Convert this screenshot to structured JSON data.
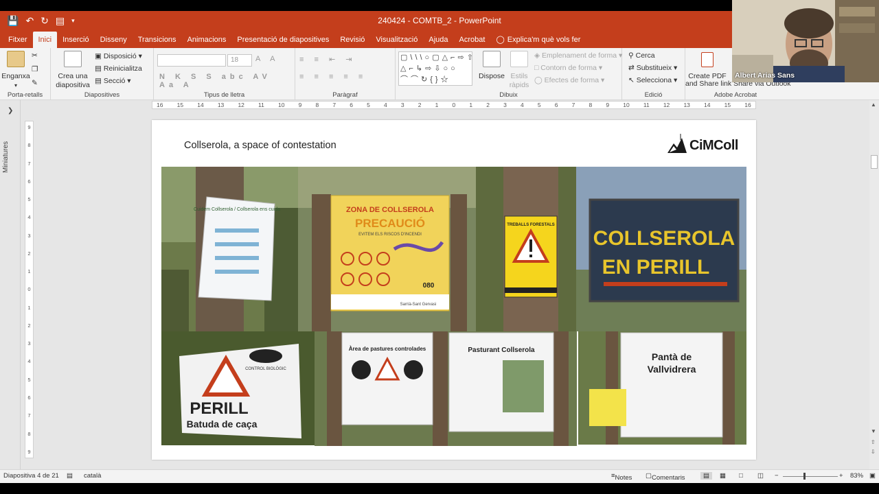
{
  "window": {
    "title": "240424 - COMTB_2  -  PowerPoint"
  },
  "menu": {
    "tabs": [
      "Fitxer",
      "Inici",
      "Inserció",
      "Disseny",
      "Transicions",
      "Animacions",
      "Presentació de diapositives",
      "Revisió",
      "Visualització",
      "Ajuda",
      "Acrobat"
    ],
    "active": "Inici",
    "tell_me": "Explica'm què vols fer"
  },
  "ribbon": {
    "clipboard": {
      "paste": "Enganxa",
      "label": "Porta-retalls"
    },
    "slides": {
      "new_slide_1": "Crea una",
      "new_slide_2": "diapositiva",
      "layout": "Disposició",
      "reset": "Reinicialitza",
      "section": "Secció",
      "label": "Diapositives"
    },
    "font": {
      "size": "18",
      "label": "Tipus de lletra"
    },
    "paragraph": {
      "label": "Paràgraf"
    },
    "drawing": {
      "arrange": "Dispose",
      "quick_styles_1": "Estils",
      "quick_styles_2": "ràpids",
      "fill": "Emplenament de forma",
      "outline": "Contorn de forma",
      "effects": "Efectes de forma",
      "label": "Dibuix"
    },
    "editing": {
      "find": "Cerca",
      "replace": "Substitueix",
      "select": "Selecciona",
      "label": "Edició"
    },
    "acrobat": {
      "create_pdf": "Create PDF",
      "share_link": "and Share link",
      "label": "Adobe Acrobat"
    },
    "share_outlook": "Share via Outlook"
  },
  "panes": {
    "thumbnails_label": "Miniatures"
  },
  "ruler": {
    "h_ticks": [
      "16",
      "15",
      "14",
      "13",
      "12",
      "11",
      "10",
      "9",
      "8",
      "7",
      "6",
      "5",
      "4",
      "3",
      "2",
      "1",
      "0",
      "1",
      "2",
      "3",
      "4",
      "5",
      "6",
      "7",
      "8",
      "9",
      "10",
      "11",
      "12",
      "13",
      "14",
      "15",
      "16"
    ],
    "v_ticks": [
      "9",
      "8",
      "7",
      "6",
      "5",
      "4",
      "3",
      "2",
      "1",
      "0",
      "1",
      "2",
      "3",
      "4",
      "5",
      "6",
      "7",
      "8",
      "9"
    ]
  },
  "slide": {
    "title": "Collserola, a space of contestation",
    "logo_text": "CiMColl",
    "photos": [
      {
        "id": "p1",
        "sign_text": "Cuidem Collserola / Collserola ens cuida"
      },
      {
        "id": "p2",
        "sign_top": "ZONA DE COLLSEROLA",
        "sign_main": "PRECAUCIÓ",
        "sign_sub": "EVITEM ELS RISCOS D'INCENDI",
        "sign_num": "080",
        "sign_footer": "Sarrià-Sant Gervasi"
      },
      {
        "id": "p3",
        "sign_text": "TREBALLS FORESTALS"
      },
      {
        "id": "p4",
        "sign_line1": "COLLSEROLA",
        "sign_line2": "EN PERILL"
      },
      {
        "id": "p5",
        "sign_text": "CONTROL BIOLÒGIC",
        "sign_main": "PERILL",
        "sign_sub": "Batuda de caça"
      },
      {
        "id": "p6",
        "sign_title": "Àrea de pastures controlades"
      },
      {
        "id": "p7",
        "sign_title": "Pasturant Collserola"
      },
      {
        "id": "p8",
        "sign_line1": "Pantà de",
        "sign_line2": "Vallvidrera"
      }
    ]
  },
  "status": {
    "slide_info": "Diapositiva 4 de 21",
    "language": "català",
    "notes": "Notes",
    "comments": "Comentaris",
    "zoom": "83%"
  },
  "webcam": {
    "name": "Albert Arias Sans"
  },
  "colors": {
    "accent": "#c43e1c",
    "ribbon_bg": "#f3f3f3",
    "workspace_bg": "#e6e6e6"
  }
}
